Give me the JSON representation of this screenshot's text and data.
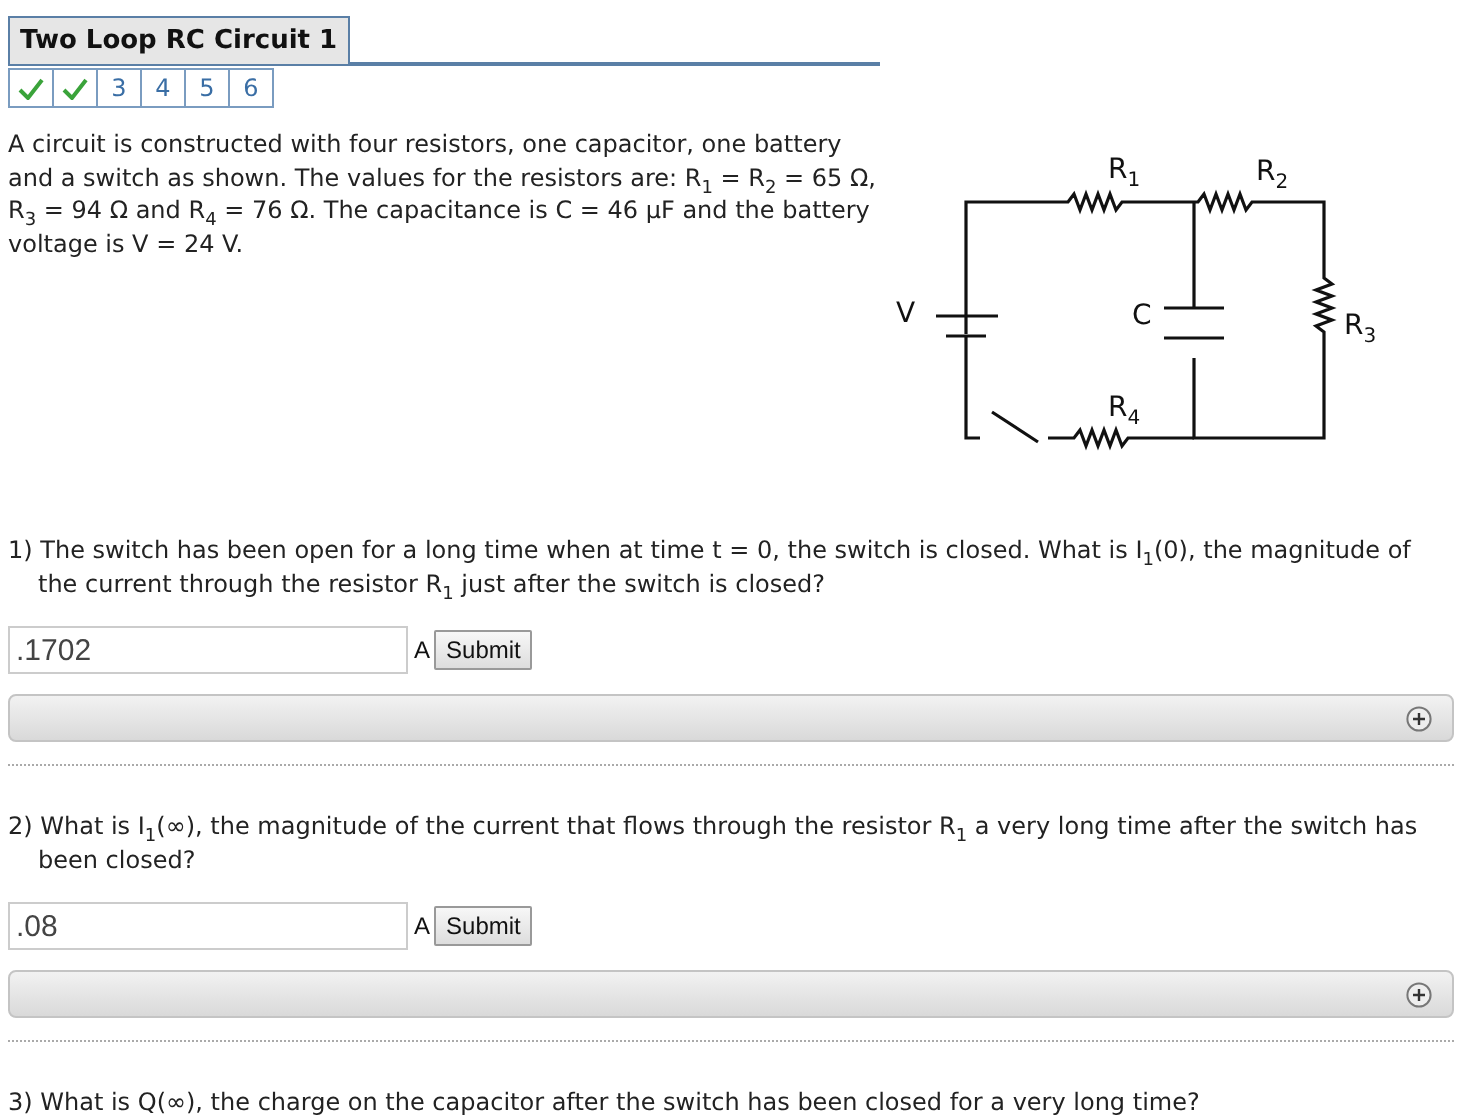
{
  "title": "Two Loop RC Circuit 1",
  "tabs": [
    {
      "kind": "done"
    },
    {
      "kind": "done"
    },
    {
      "kind": "number",
      "label": "3"
    },
    {
      "kind": "number",
      "label": "4"
    },
    {
      "kind": "number",
      "label": "5"
    },
    {
      "kind": "number",
      "label": "6"
    }
  ],
  "intro": "A circuit is constructed with four resistors, one capacitor, one battery and a switch as shown. The values for the resistors are: R$_{1}$ = R$_{2}$ = 65 Ω, R$_{3}$ = 94 Ω and R$_{4}$ = 76 Ω. The capacitance is C = 46 μF and the battery voltage is V = 24 V.",
  "circuit": {
    "labels": [
      {
        "kind": "V",
        "text": "V"
      },
      {
        "kind": "C",
        "text": "C"
      },
      {
        "kind": "R1",
        "text": "R$_{1}$"
      },
      {
        "kind": "R2",
        "text": "R$_{2}$"
      },
      {
        "kind": "R3",
        "text": "R$_{3}$"
      },
      {
        "kind": "R4",
        "text": "R$_{4}$"
      }
    ]
  },
  "questions": [
    {
      "number": "1)",
      "text": "The switch has been open for a long time when at time t = 0, the switch is closed. What is I$_{1}$(0), the magnitude of the current through the resistor R$_{1}$ just after the switch is closed?",
      "answer": {
        "value": ".1702",
        "unit": "A",
        "button": "Submit"
      },
      "hint_bar": {
        "expanded": false
      }
    },
    {
      "number": "2)",
      "text": "What is I$_{1}$(∞), the magnitude of the current that flows through the resistor R$_{1}$ a very long time after the switch has been closed?",
      "answer": {
        "value": ".08",
        "unit": "A",
        "button": "Submit"
      },
      "hint_bar": {
        "expanded": false
      }
    },
    {
      "number": "3)",
      "text": "What is Q(∞), the charge on the capacitor after the switch has been closed for a very long time?"
    }
  ]
}
